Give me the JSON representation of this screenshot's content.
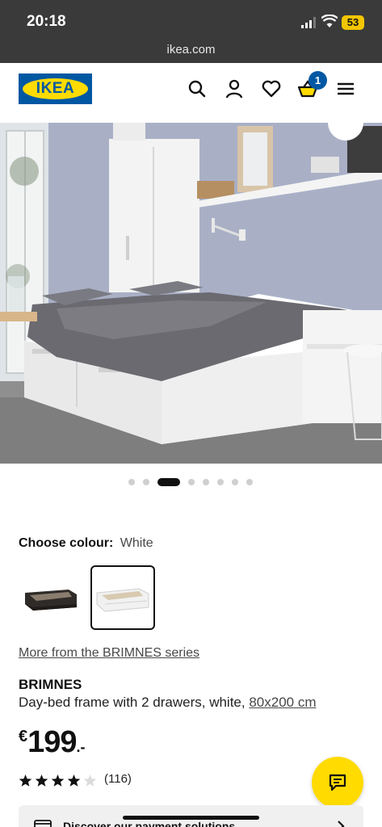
{
  "status_bar": {
    "time": "20:18",
    "battery": "53",
    "url": "ikea.com"
  },
  "header": {
    "logo_text": "IKEA",
    "icons": [
      "search-icon",
      "user-icon",
      "heart-icon",
      "cart-icon",
      "menu-icon"
    ],
    "cart_count": "1"
  },
  "gallery": {
    "slide_count": 8,
    "active_index": 2
  },
  "colour": {
    "label": "Choose colour:",
    "selected": "White",
    "options": [
      {
        "name": "black-brown",
        "color": "#2f2b28"
      },
      {
        "name": "white",
        "color": "#ececec"
      }
    ]
  },
  "product": {
    "series_link": "More from the BRIMNES series",
    "name": "BRIMNES",
    "description": "Day-bed frame with 2 drawers, white, ",
    "size": "80x200 cm",
    "price_currency": "€",
    "price_whole": "199",
    "price_decimals": ".-",
    "rating": 4,
    "rating_max": 5,
    "reviews": "(116)"
  },
  "payment": {
    "text": "Discover our payment solutions"
  },
  "colors": {
    "brand_blue": "#0058a3",
    "brand_yellow": "#ffdb00",
    "status_bar": "#3a3a3a"
  }
}
